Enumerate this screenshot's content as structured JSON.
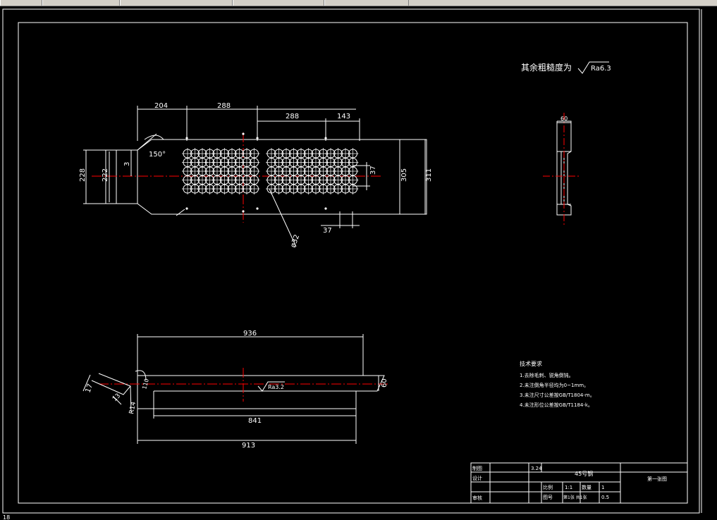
{
  "app": {
    "status_prefix": "18"
  },
  "colors": {
    "background": "#000000",
    "linework": "#ffffff",
    "centerline": "#ff0000",
    "toolbar": "#d4d0c8"
  },
  "roughness_note": {
    "text": "其余粗糙度为",
    "symbol_value": "Ra6.3"
  },
  "top_view": {
    "dimensions": [
      "204",
      "288",
      "288",
      "143",
      "228",
      "222",
      "3",
      "150°",
      "37",
      "305",
      "311",
      "37",
      "ø32"
    ]
  },
  "side_view": {
    "dimensions": [
      "60"
    ]
  },
  "bottom_view": {
    "dimensions": [
      "936",
      "17",
      "13",
      "R14",
      "110",
      "60",
      "841",
      "913"
    ],
    "roughness_symbol": "Ra3.2"
  },
  "tech_requirements": {
    "title": "技术要求",
    "items": [
      "1.去除毛刺、锐角倒钝。",
      "2.未注倒角半径均为0~1mm。",
      "3.未注尺寸公差按GB/T1804-m。",
      "4.未注形位公差按GB/T1184-k。"
    ]
  },
  "title_block": {
    "row1_label": "制图",
    "row1_value": "3.24",
    "row2_label": "设计",
    "row4_label": "审核",
    "material": "45号钢",
    "drawing_name": "第一张图",
    "scale_label": "比例",
    "scale_value": "1:1",
    "quantity_label": "数量",
    "quantity_value": "1",
    "sheet_label": "图号",
    "sheet_value": "第1张 共1张",
    "weight_value": "0.5"
  }
}
